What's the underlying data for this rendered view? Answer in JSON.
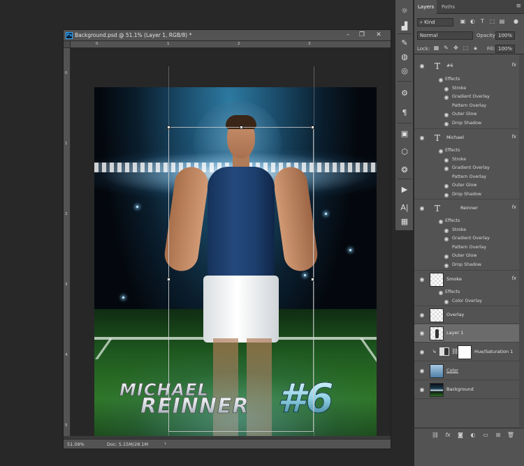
{
  "document": {
    "title": "Background.psd @ 51.1% (Layer 1, RGB/8) *",
    "badge": "Ps",
    "window_buttons": {
      "minimize": "–",
      "restore": "❐",
      "close": "✕"
    },
    "rulers": {
      "horizontal": [
        "0",
        "1",
        "2",
        "3"
      ],
      "vertical": [
        "0",
        "1",
        "2",
        "3",
        "4",
        "5"
      ]
    },
    "artwork": {
      "name_first": "MICHAEL",
      "name_last": "REINNER",
      "number": "#6"
    },
    "status": {
      "zoom": "51.09%",
      "doc_info": "Doc: 5.15M/28.1M",
      "arrow": "›"
    }
  },
  "tools": [
    {
      "icon": "sun-icon",
      "glyph": "☼"
    },
    {
      "icon": "histogram-icon",
      "glyph": "▟"
    },
    {
      "icon": "brush-icon",
      "glyph": "✎"
    },
    {
      "icon": "swatches-icon",
      "glyph": "◍"
    },
    {
      "icon": "cc-libraries-icon",
      "glyph": "◎"
    },
    {
      "icon": "adjustments-icon",
      "glyph": "⚙"
    },
    {
      "icon": "paragraph-icon",
      "glyph": "¶"
    },
    {
      "icon": "artboard-icon",
      "glyph": "▣"
    },
    {
      "icon": "3d-cube-icon",
      "glyph": "⬡"
    },
    {
      "icon": "channels-icon",
      "glyph": "❂"
    },
    {
      "icon": "play-actions-icon",
      "glyph": "▶"
    },
    {
      "icon": "character-icon",
      "glyph": "A|"
    },
    {
      "icon": "grid-table-icon",
      "glyph": "▦"
    }
  ],
  "layers_panel": {
    "tabs": [
      "Layers",
      "Paths"
    ],
    "menu": "≡",
    "filter_kind": "Kind",
    "blend_mode": "Normal",
    "opacity_label": "Opacity:",
    "opacity_value": "100%",
    "lock_label": "Lock:",
    "fill_label": "Fill:",
    "fill_value": "100%",
    "layers": [
      {
        "name": "#6",
        "kind": "type",
        "fx": "fx",
        "effects": [
          "Stroke",
          "Gradient Overlay",
          "Pattern Overlay",
          "Outer Glow",
          "Drop Shadow"
        ]
      },
      {
        "name": "Michael",
        "kind": "type",
        "fx": "fx",
        "effects": [
          "Stroke",
          "Gradient Overlay",
          "Pattern Overlay",
          "Outer Glow",
          "Drop Shadow"
        ]
      },
      {
        "name": "Reinner",
        "kind": "type",
        "fx": "fx",
        "effects": [
          "Stroke",
          "Gradient Overlay",
          "Pattern Overlay",
          "Outer Glow",
          "Drop Shadow"
        ]
      },
      {
        "name": "Smoke",
        "kind": "pixel",
        "fx": "fx",
        "effects": [
          "Color Overlay"
        ]
      },
      {
        "name": "Overlay",
        "kind": "pixel"
      },
      {
        "name": "Layer 1",
        "kind": "pixel",
        "selected": true
      },
      {
        "name": "Hue/Saturation 1",
        "kind": "adjustment"
      },
      {
        "name": "Color",
        "kind": "fill"
      },
      {
        "name": "Background",
        "kind": "image"
      }
    ],
    "effects_label": "Effects",
    "footer_icons": [
      "link-icon",
      "fx-icon",
      "mask-icon",
      "adjustment-icon",
      "group-folder-icon",
      "new-layer-icon",
      "trash-icon"
    ]
  }
}
